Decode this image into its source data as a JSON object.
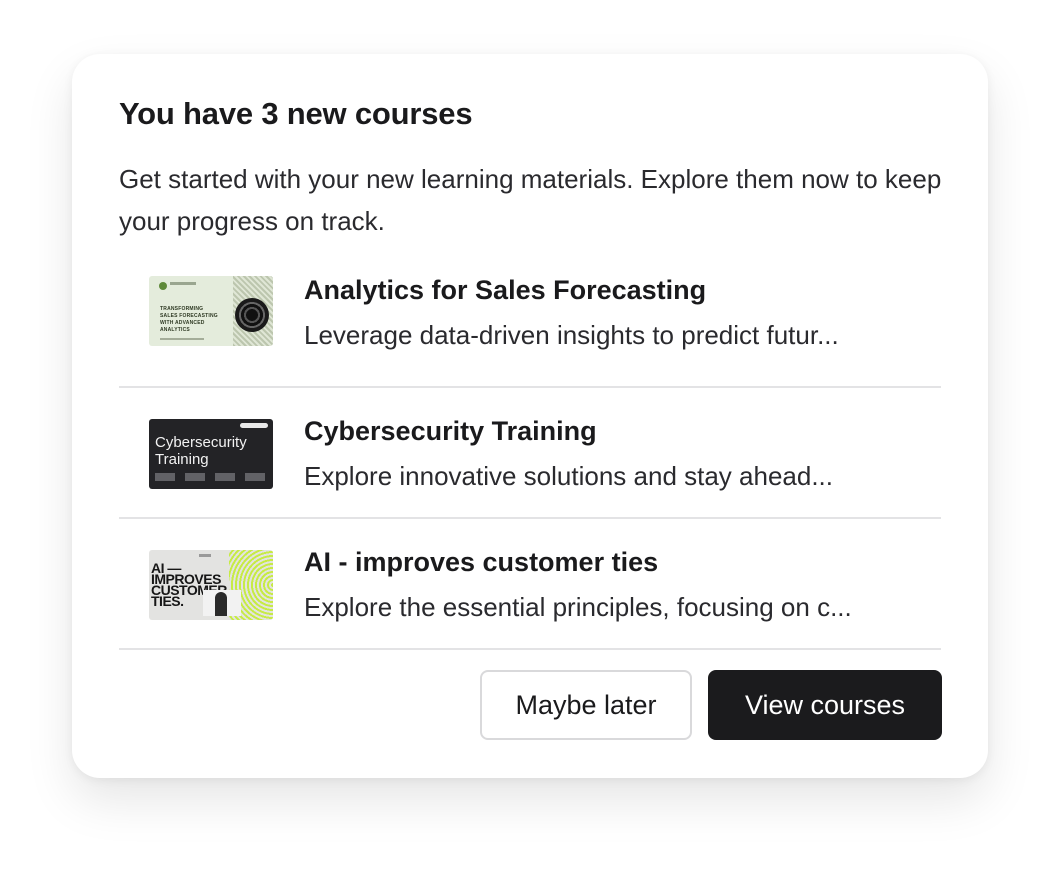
{
  "dialog": {
    "title": "You have 3 new courses",
    "description": "Get started with your new learning materials. Explore them now to keep your progress on track."
  },
  "courses": [
    {
      "title": "Analytics for Sales Forecasting",
      "description": "Leverage data-driven insights to predict futur...",
      "thumbnail_text": "TRANSFORMING SALES FORECASTING WITH ADVANCED ANALYTICS"
    },
    {
      "title": "Cybersecurity Training",
      "description": "Explore innovative solutions and stay ahead...",
      "thumbnail_text": "Cybersecurity Training"
    },
    {
      "title": "AI - improves customer ties",
      "description": "Explore the essential principles, focusing on c...",
      "thumbnail_text": "AI — IMPROVES CUSTOMER TIES."
    }
  ],
  "actions": {
    "secondary_label": "Maybe later",
    "primary_label": "View courses"
  },
  "colors": {
    "primary_button": "#1b1b1d",
    "divider": "#e3e3e5",
    "lime_accent": "#c7eb45"
  }
}
